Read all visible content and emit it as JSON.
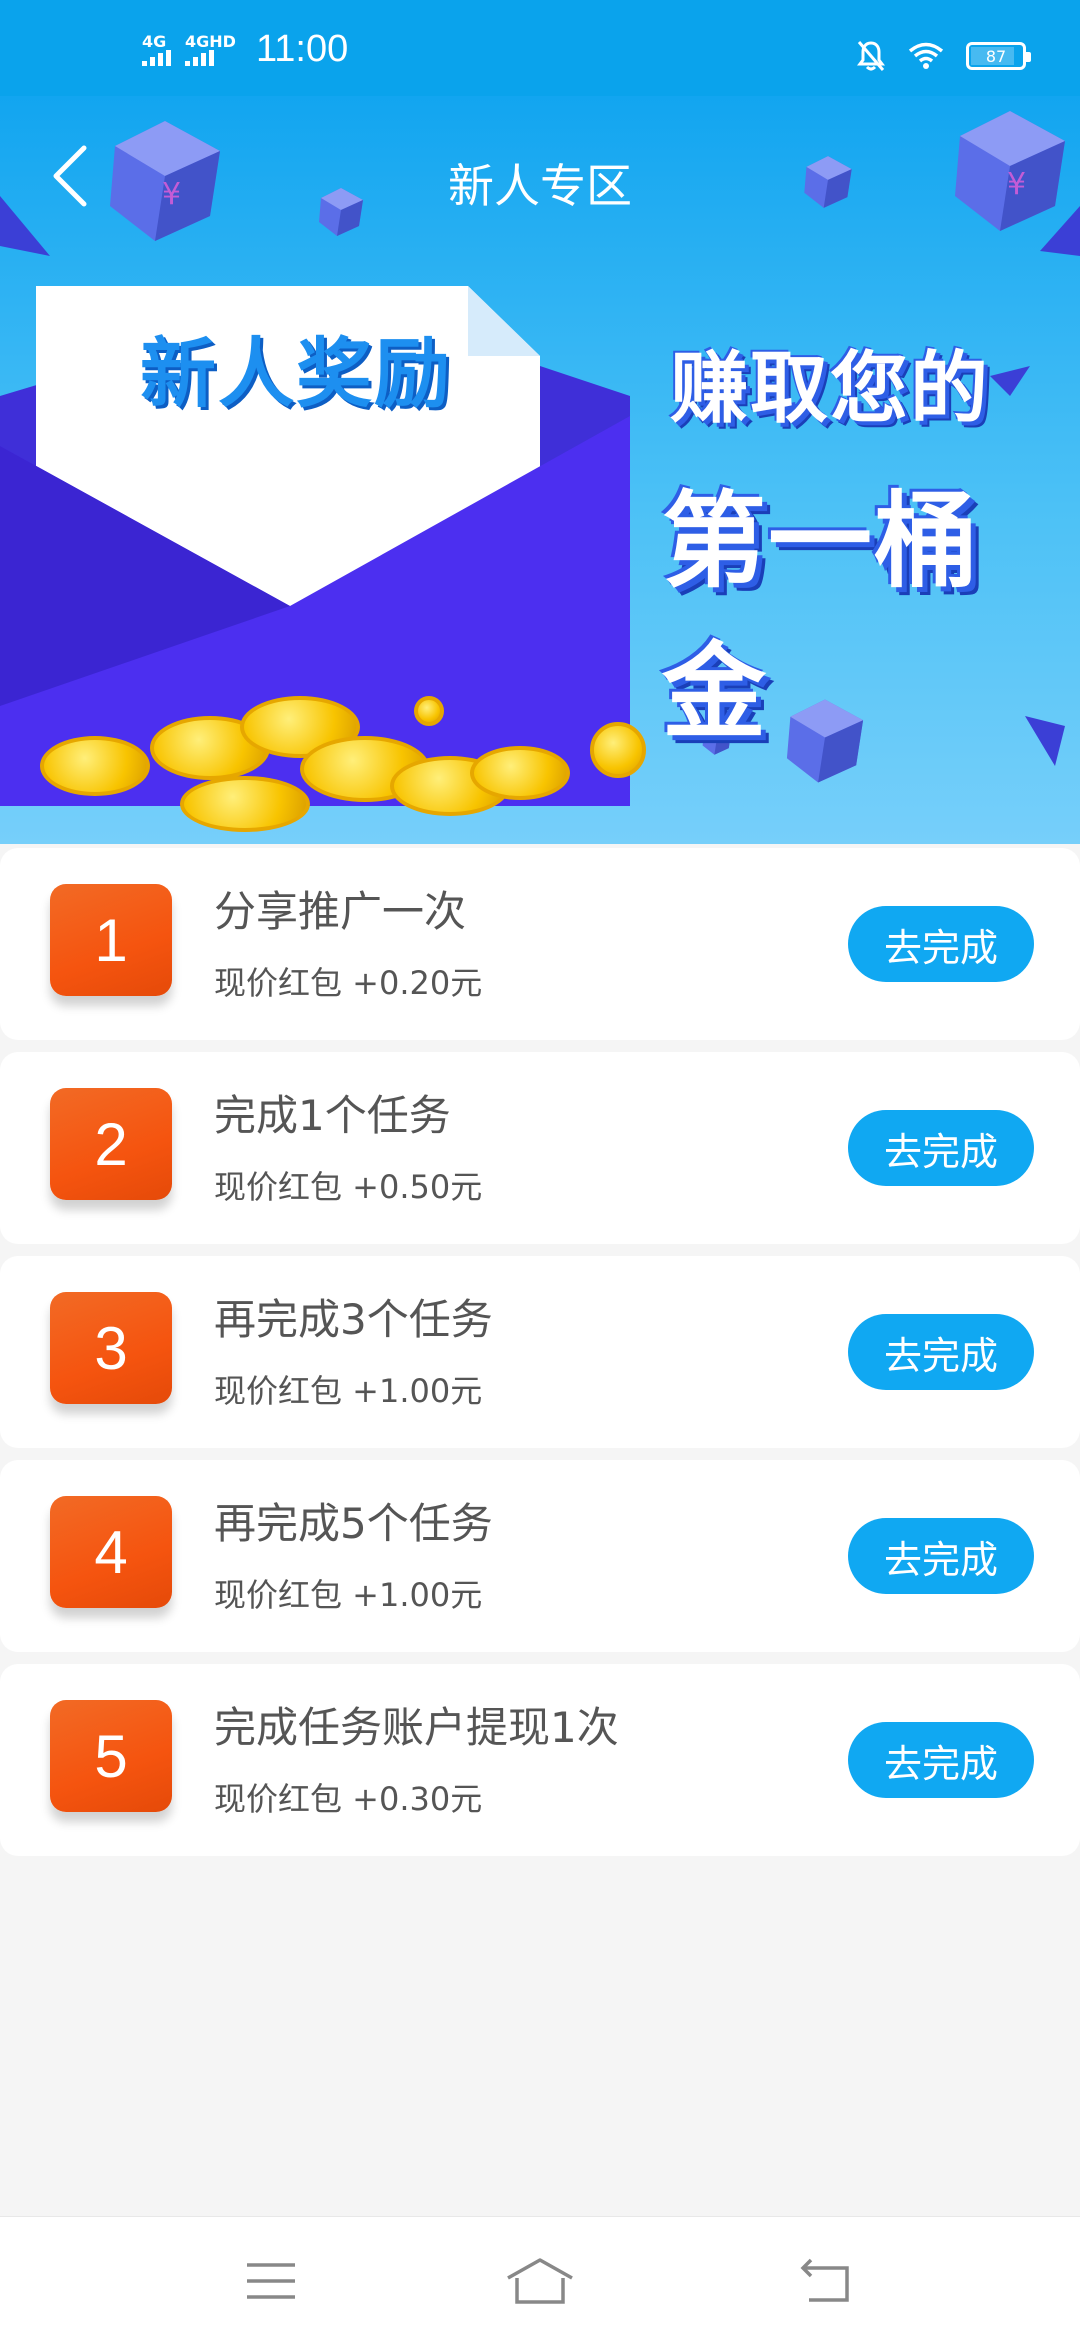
{
  "status_bar": {
    "net1": "4G",
    "net2": "4GHD",
    "time": "11:00",
    "battery": "87",
    "icons": [
      "mute-bell-icon",
      "wifi-icon",
      "battery-icon"
    ]
  },
  "header": {
    "title": "新人专区",
    "back_icon": "chevron-left-icon"
  },
  "banner": {
    "card_title": "新人奖励",
    "slogan_line1": "赚取您的",
    "slogan_line2": "第一桶金"
  },
  "tasks": [
    {
      "num": "1",
      "title": "分享推广一次",
      "reward": "现价红包 +0.20元",
      "button": "去完成"
    },
    {
      "num": "2",
      "title": "完成1个任务",
      "reward": "现价红包 +0.50元",
      "button": "去完成"
    },
    {
      "num": "3",
      "title": "再完成3个任务",
      "reward": "现价红包 +1.00元",
      "button": "去完成"
    },
    {
      "num": "4",
      "title": "再完成5个任务",
      "reward": "现价红包 +1.00元",
      "button": "去完成"
    },
    {
      "num": "5",
      "title": "完成任务账户提现1次",
      "reward": "现价红包 +0.30元",
      "button": "去完成"
    }
  ],
  "nav_bar": {
    "icons": [
      "menu-icon",
      "home-icon",
      "back-icon"
    ]
  },
  "colors": {
    "accent": "#10a8f2",
    "badge": "#f5540f",
    "banner_top": "#12a5f0"
  }
}
